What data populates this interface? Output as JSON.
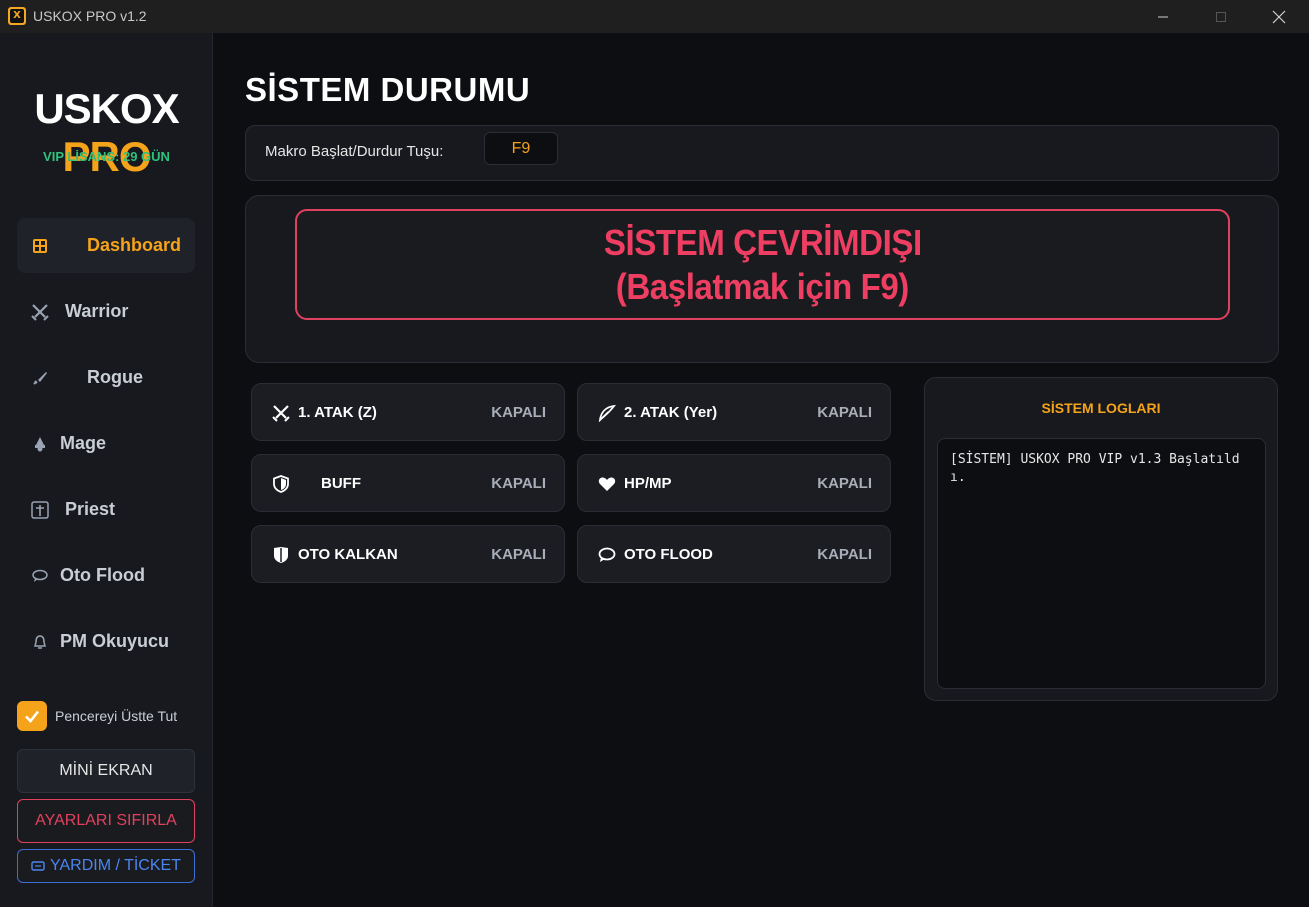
{
  "window": {
    "title": "USKOX PRO v1.2",
    "icon_letter": "X",
    "controls": [
      "minimize-icon",
      "maximize-icon",
      "close-icon"
    ]
  },
  "sidebar": {
    "logo_part1": "USKOX",
    "logo_part2": "PRO",
    "license": "VIP LİSANS: 29 GÜN",
    "items": [
      {
        "label": "Dashboard",
        "icon": "dashboard-icon",
        "active": true
      },
      {
        "label": "Warrior",
        "icon": "crossed-swords-icon",
        "active": false
      },
      {
        "label": "Rogue",
        "icon": "dagger-icon",
        "active": false
      },
      {
        "label": "Mage",
        "icon": "wizard-icon",
        "active": false
      },
      {
        "label": "Priest",
        "icon": "cross-icon",
        "active": false
      },
      {
        "label": "Oto Flood",
        "icon": "chat-bubble-icon",
        "active": false
      },
      {
        "label": "PM Okuyucu",
        "icon": "bell-icon",
        "active": false
      }
    ],
    "pin_window": {
      "label": "Pencereyi Üstte Tut",
      "checked": true
    },
    "mini_button": "MİNİ EKRAN",
    "reset_button": "AYARLARI SIFIRLA",
    "help_button": "YARDIM / TİCKET"
  },
  "main": {
    "title": "SİSTEM DURUMU",
    "hotkey": {
      "label": "Makro Başlat/Durdur Tuşu:",
      "value": "F9"
    },
    "status": {
      "line1": "SİSTEM ÇEVRİMDIŞI",
      "line2": "(Başlatmak için F9)"
    },
    "features": [
      {
        "name": "1. ATAK (Z)",
        "state": "KAPALI",
        "icon": "crossed-swords-icon"
      },
      {
        "name": "2. ATAK (Yer)",
        "state": "KAPALI",
        "icon": "feather-icon"
      },
      {
        "name": "BUFF",
        "state": "KAPALI",
        "icon": "shield-icon"
      },
      {
        "name": "HP/MP",
        "state": "KAPALI",
        "icon": "heart-icon"
      },
      {
        "name": "OTO KALKAN",
        "state": "KAPALI",
        "icon": "kite-shield-icon"
      },
      {
        "name": "OTO FLOOD",
        "state": "KAPALI",
        "icon": "chat-bubble-icon"
      }
    ],
    "logs": {
      "title": "SİSTEM LOGLARI",
      "content": "[SİSTEM] USKOX PRO VIP v1.3 Başlatıldı."
    }
  },
  "colors": {
    "accent": "#f5a31a",
    "danger": "#e0415e",
    "success": "#2ec27e",
    "link": "#4a86f0"
  }
}
